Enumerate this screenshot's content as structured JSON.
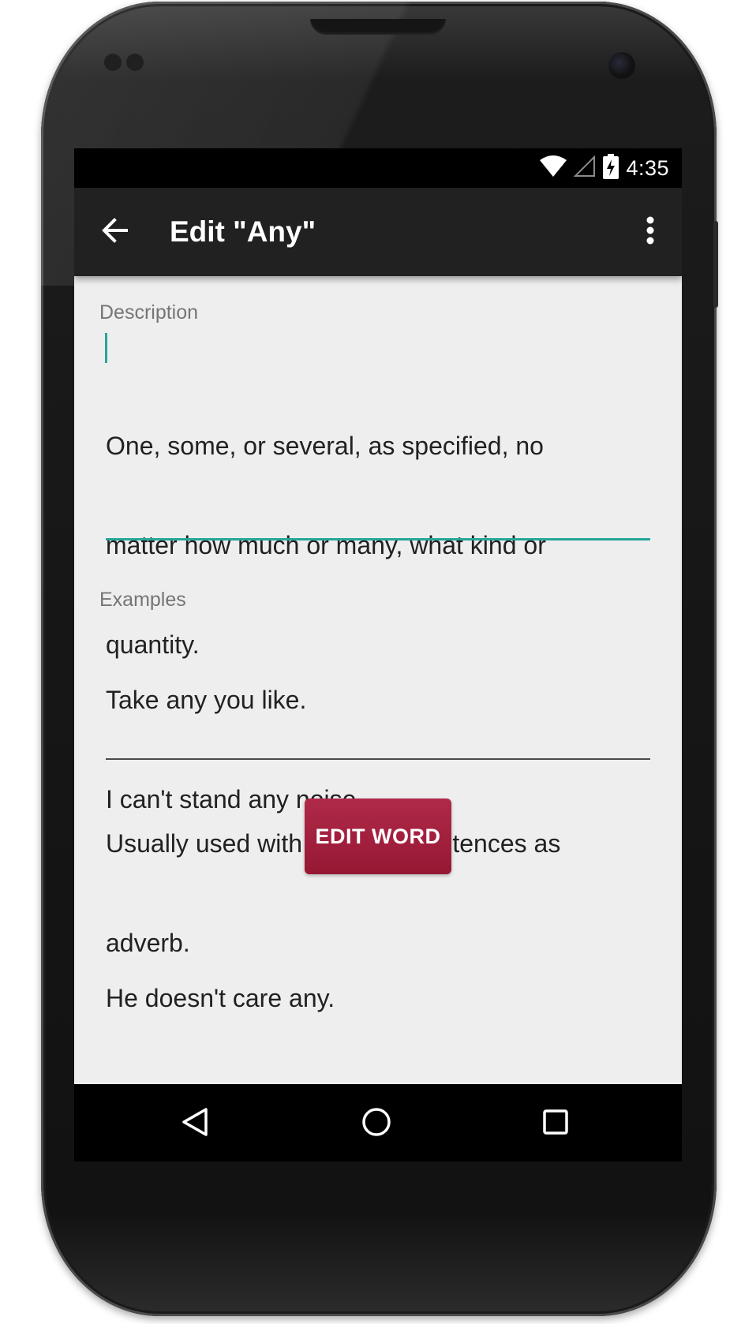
{
  "status_bar": {
    "time": "4:35",
    "icons": [
      "wifi-icon",
      "cell-signal-icon",
      "battery-charging-icon"
    ]
  },
  "app_bar": {
    "title": "Edit \"Any\"",
    "back_icon": "arrow-left-icon",
    "menu_icon": "more-vertical-icon"
  },
  "form": {
    "description": {
      "label": "Description",
      "lines": [
        "One, some, or several, as specified, no",
        "matter how much or many, what kind or",
        "quantity.",
        "",
        "Usually used with negative sentences as",
        "adverb."
      ]
    },
    "examples": {
      "label": "Examples",
      "lines": [
        "Take any you like.",
        "I can't stand any noise.",
        "",
        "He doesn't care any."
      ]
    },
    "submit_label": "EDIT WORD"
  },
  "nav_bar": {
    "icons": [
      "back-triangle-icon",
      "home-circle-icon",
      "recents-square-icon"
    ]
  },
  "colors": {
    "accent": "#26a69a",
    "button": "#a32140",
    "app_bar": "#212121",
    "background": "#eeeeee"
  }
}
